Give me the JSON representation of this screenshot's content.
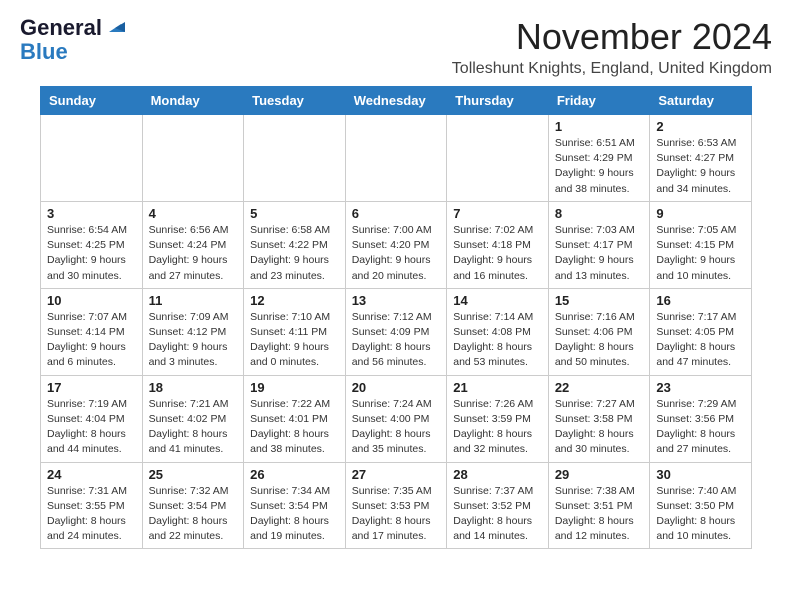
{
  "header": {
    "logo_line1": "General",
    "logo_line2": "Blue",
    "month_title": "November 2024",
    "location": "Tolleshunt Knights, England, United Kingdom"
  },
  "weekdays": [
    "Sunday",
    "Monday",
    "Tuesday",
    "Wednesday",
    "Thursday",
    "Friday",
    "Saturday"
  ],
  "weeks": [
    [
      {
        "day": "",
        "info": ""
      },
      {
        "day": "",
        "info": ""
      },
      {
        "day": "",
        "info": ""
      },
      {
        "day": "",
        "info": ""
      },
      {
        "day": "",
        "info": ""
      },
      {
        "day": "1",
        "info": "Sunrise: 6:51 AM\nSunset: 4:29 PM\nDaylight: 9 hours\nand 38 minutes."
      },
      {
        "day": "2",
        "info": "Sunrise: 6:53 AM\nSunset: 4:27 PM\nDaylight: 9 hours\nand 34 minutes."
      }
    ],
    [
      {
        "day": "3",
        "info": "Sunrise: 6:54 AM\nSunset: 4:25 PM\nDaylight: 9 hours\nand 30 minutes."
      },
      {
        "day": "4",
        "info": "Sunrise: 6:56 AM\nSunset: 4:24 PM\nDaylight: 9 hours\nand 27 minutes."
      },
      {
        "day": "5",
        "info": "Sunrise: 6:58 AM\nSunset: 4:22 PM\nDaylight: 9 hours\nand 23 minutes."
      },
      {
        "day": "6",
        "info": "Sunrise: 7:00 AM\nSunset: 4:20 PM\nDaylight: 9 hours\nand 20 minutes."
      },
      {
        "day": "7",
        "info": "Sunrise: 7:02 AM\nSunset: 4:18 PM\nDaylight: 9 hours\nand 16 minutes."
      },
      {
        "day": "8",
        "info": "Sunrise: 7:03 AM\nSunset: 4:17 PM\nDaylight: 9 hours\nand 13 minutes."
      },
      {
        "day": "9",
        "info": "Sunrise: 7:05 AM\nSunset: 4:15 PM\nDaylight: 9 hours\nand 10 minutes."
      }
    ],
    [
      {
        "day": "10",
        "info": "Sunrise: 7:07 AM\nSunset: 4:14 PM\nDaylight: 9 hours\nand 6 minutes."
      },
      {
        "day": "11",
        "info": "Sunrise: 7:09 AM\nSunset: 4:12 PM\nDaylight: 9 hours\nand 3 minutes."
      },
      {
        "day": "12",
        "info": "Sunrise: 7:10 AM\nSunset: 4:11 PM\nDaylight: 9 hours\nand 0 minutes."
      },
      {
        "day": "13",
        "info": "Sunrise: 7:12 AM\nSunset: 4:09 PM\nDaylight: 8 hours\nand 56 minutes."
      },
      {
        "day": "14",
        "info": "Sunrise: 7:14 AM\nSunset: 4:08 PM\nDaylight: 8 hours\nand 53 minutes."
      },
      {
        "day": "15",
        "info": "Sunrise: 7:16 AM\nSunset: 4:06 PM\nDaylight: 8 hours\nand 50 minutes."
      },
      {
        "day": "16",
        "info": "Sunrise: 7:17 AM\nSunset: 4:05 PM\nDaylight: 8 hours\nand 47 minutes."
      }
    ],
    [
      {
        "day": "17",
        "info": "Sunrise: 7:19 AM\nSunset: 4:04 PM\nDaylight: 8 hours\nand 44 minutes."
      },
      {
        "day": "18",
        "info": "Sunrise: 7:21 AM\nSunset: 4:02 PM\nDaylight: 8 hours\nand 41 minutes."
      },
      {
        "day": "19",
        "info": "Sunrise: 7:22 AM\nSunset: 4:01 PM\nDaylight: 8 hours\nand 38 minutes."
      },
      {
        "day": "20",
        "info": "Sunrise: 7:24 AM\nSunset: 4:00 PM\nDaylight: 8 hours\nand 35 minutes."
      },
      {
        "day": "21",
        "info": "Sunrise: 7:26 AM\nSunset: 3:59 PM\nDaylight: 8 hours\nand 32 minutes."
      },
      {
        "day": "22",
        "info": "Sunrise: 7:27 AM\nSunset: 3:58 PM\nDaylight: 8 hours\nand 30 minutes."
      },
      {
        "day": "23",
        "info": "Sunrise: 7:29 AM\nSunset: 3:56 PM\nDaylight: 8 hours\nand 27 minutes."
      }
    ],
    [
      {
        "day": "24",
        "info": "Sunrise: 7:31 AM\nSunset: 3:55 PM\nDaylight: 8 hours\nand 24 minutes."
      },
      {
        "day": "25",
        "info": "Sunrise: 7:32 AM\nSunset: 3:54 PM\nDaylight: 8 hours\nand 22 minutes."
      },
      {
        "day": "26",
        "info": "Sunrise: 7:34 AM\nSunset: 3:54 PM\nDaylight: 8 hours\nand 19 minutes."
      },
      {
        "day": "27",
        "info": "Sunrise: 7:35 AM\nSunset: 3:53 PM\nDaylight: 8 hours\nand 17 minutes."
      },
      {
        "day": "28",
        "info": "Sunrise: 7:37 AM\nSunset: 3:52 PM\nDaylight: 8 hours\nand 14 minutes."
      },
      {
        "day": "29",
        "info": "Sunrise: 7:38 AM\nSunset: 3:51 PM\nDaylight: 8 hours\nand 12 minutes."
      },
      {
        "day": "30",
        "info": "Sunrise: 7:40 AM\nSunset: 3:50 PM\nDaylight: 8 hours\nand 10 minutes."
      }
    ]
  ]
}
